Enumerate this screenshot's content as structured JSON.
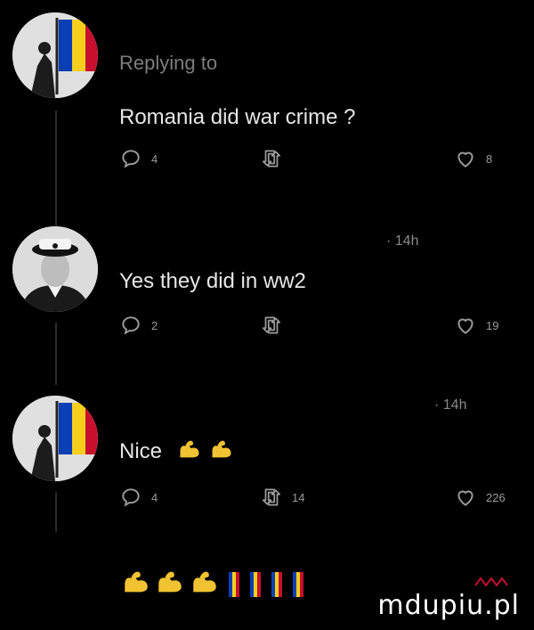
{
  "tweets": [
    {
      "reply_label": "Replying to",
      "text": "Romania did war crime ?",
      "reply_count": "4",
      "retweet_count": "",
      "like_count": "8"
    },
    {
      "time": "· 14h",
      "text": "Yes they did in ww2",
      "reply_count": "2",
      "retweet_count": "",
      "like_count": "19"
    },
    {
      "time": "· 14h",
      "text": "Nice",
      "reply_count": "4",
      "retweet_count": "14",
      "like_count": "226"
    }
  ],
  "caption_flags_count": 4,
  "watermark": "mdupiu.pl",
  "colors": {
    "flag_blue": "#0b3fb5",
    "flag_yellow": "#f5cf1c",
    "flag_red": "#c8102e",
    "muscle": "#f1c232"
  }
}
